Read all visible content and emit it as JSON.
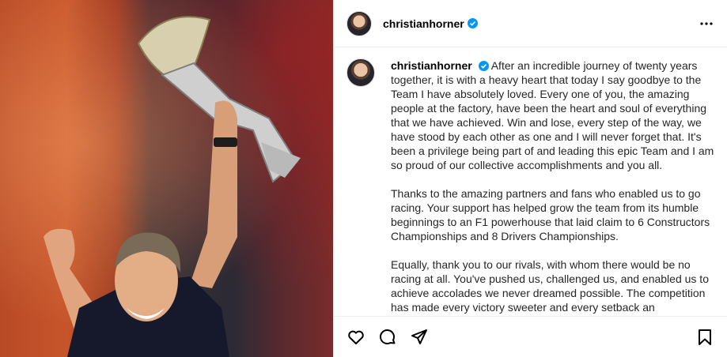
{
  "post": {
    "username": "christianhorner",
    "verified": true,
    "caption_paragraphs": [
      "After an incredible journey of twenty years together, it is with a heavy heart that today I say goodbye to the Team I have absolutely loved. Every one of you, the amazing people at the factory, have been the heart and soul of everything that we have achieved. Win and lose, every step of the way, we have stood by each other as one and I will never forget that. It's been a privilege being part of and leading this epic Team and I am so proud of our collective accomplishments and you all.",
      "Thanks to the amazing partners and fans who enabled us to go racing. Your support has helped grow the team from its humble beginnings to an F1 powerhouse that laid claim to 6 Constructors Championships and 8 Drivers Championships.",
      "Equally, thank you to our rivals, with whom there would be no racing at all. You've pushed us, challenged us, and enabled us to achieve accolades we never dreamed possible. The competition has made every victory sweeter and every setback an"
    ]
  },
  "icons": {
    "verified": "verified-badge-icon",
    "more": "more-options-icon",
    "like": "heart-icon",
    "comment": "comment-icon",
    "share": "share-icon",
    "save": "bookmark-icon"
  },
  "colors": {
    "verified_blue": "#0095f6",
    "border": "#efefef"
  }
}
